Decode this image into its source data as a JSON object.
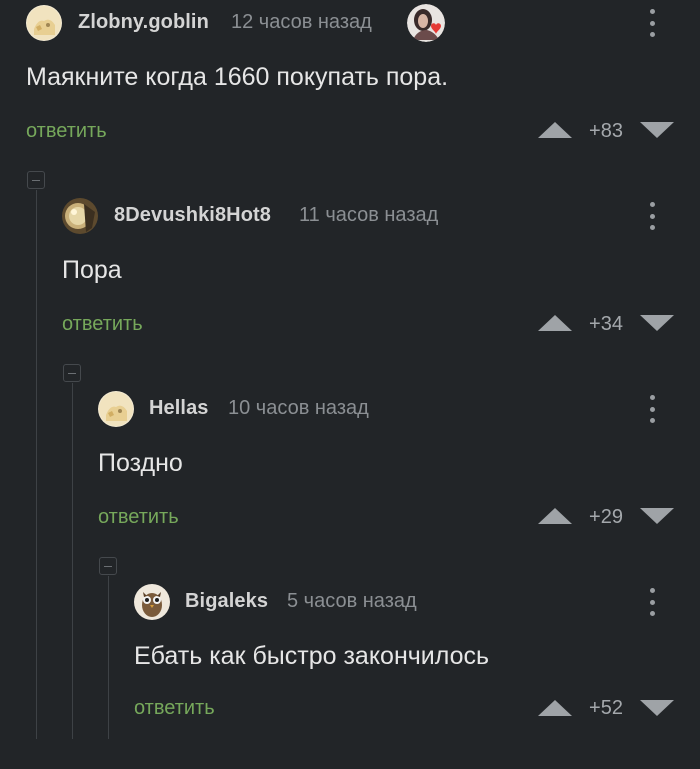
{
  "comments": [
    {
      "username": "Zlobny.goblin",
      "time": "12 часов назад",
      "text": "Маякните когда 1660 покупать пора.",
      "reply_label": "ответить",
      "score": "+83",
      "has_badge": true
    },
    {
      "username": "8Devushki8Hot8",
      "time": "11 часов назад",
      "text": "Пора",
      "reply_label": "ответить",
      "score": "+34"
    },
    {
      "username": "Hellas",
      "time": "10 часов назад",
      "text": "Поздно",
      "reply_label": "ответить",
      "score": "+29"
    },
    {
      "username": "Bigaleks",
      "time": "5 часов назад",
      "text": "Ебать как быстро закончилось",
      "reply_label": "ответить",
      "score": "+52"
    }
  ],
  "colors": {
    "background": "#222528",
    "reply_link": "#76a85b",
    "text": "#e6e6e6",
    "muted": "#8b8f93"
  },
  "icons": {
    "more": "more-vertical-icon",
    "vote_up": "triangle-up-icon",
    "vote_down": "triangle-down-icon",
    "collapse": "collapse-minus-icon"
  }
}
